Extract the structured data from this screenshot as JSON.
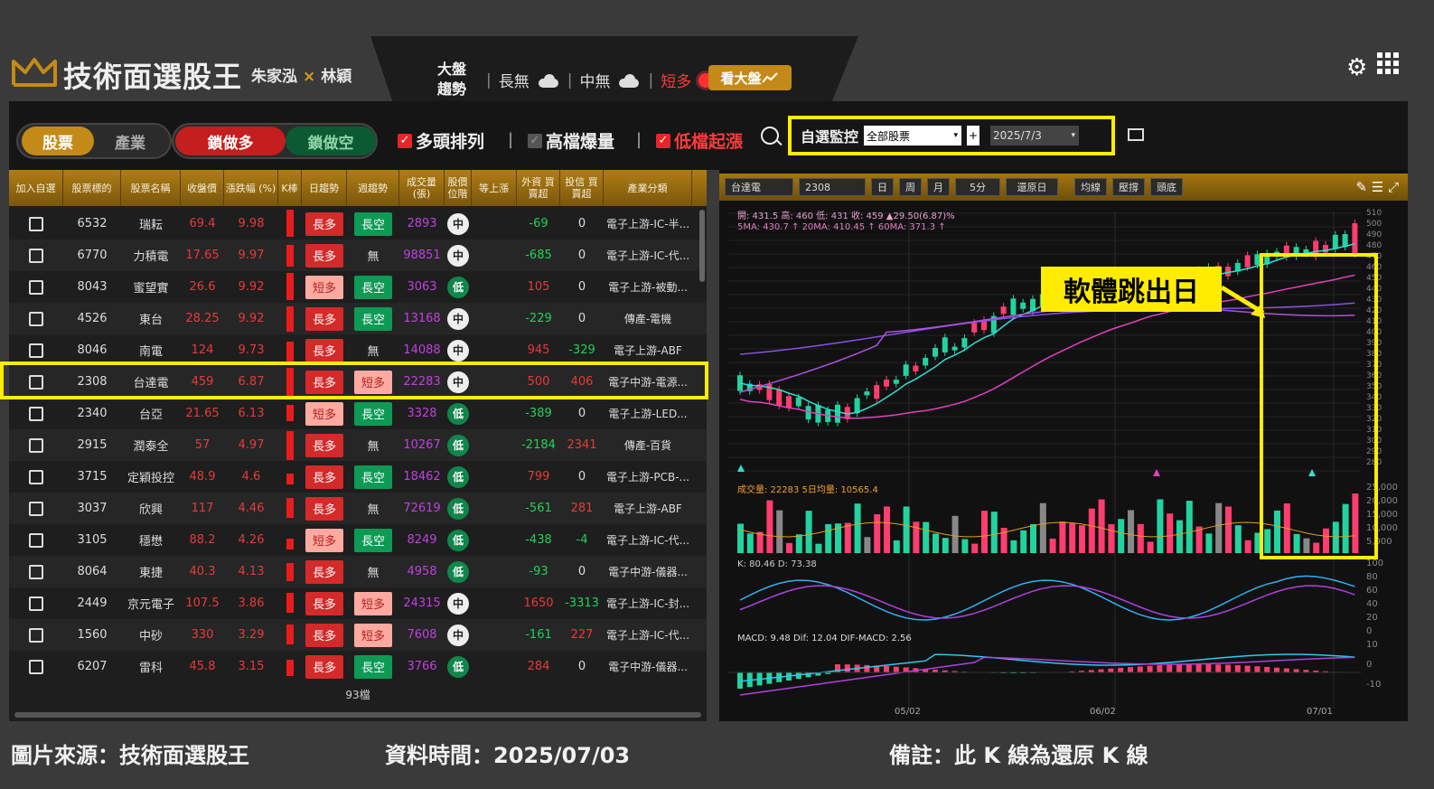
{
  "header": {
    "app_title": "技術面選股王",
    "author_1": "朱家泓",
    "author_sep": "×",
    "author_2": "林穎",
    "trend_title": "大盤趨勢",
    "trend_long": "長無",
    "trend_mid": "中無",
    "trend_short": "短多",
    "market_button": "看大盤",
    "icons": [
      "crown-logo-icon",
      "cloud-icon",
      "sun-icon",
      "chart-icon",
      "gear-icon",
      "grid-icon"
    ]
  },
  "toolbar": {
    "seg1": [
      "股票",
      "產業"
    ],
    "seg2": [
      "鎖做多",
      "鎖做空"
    ],
    "filters": [
      {
        "label": "多頭排列",
        "checked": true
      },
      {
        "label": "高檔爆量",
        "checked": false
      },
      {
        "label": "低檔起漲",
        "checked": true
      }
    ],
    "monitor_label": "自選監控",
    "monitor_select": "全部股票",
    "monitor_plus": "+",
    "date_select": "2025/7/3"
  },
  "table": {
    "headers": [
      "加入自選",
      "股票標的",
      "股票名稱",
      "收盤價",
      "漲跌幅 (%)",
      "K棒",
      "日趨勢",
      "週趨勢",
      "成交量 (張)",
      "股價位階",
      "等上漲",
      "外資 買賣超",
      "投信 買賣超",
      "產業分類"
    ],
    "rows": [
      {
        "code": "6532",
        "name": "瑞耘",
        "close": "69.4",
        "chg": "9.98",
        "day": "長多",
        "week": "長空",
        "vol": "2893",
        "pos": "中",
        "foreign": "-69",
        "trust": "0",
        "ind": "電子上游-IC-半..."
      },
      {
        "code": "6770",
        "name": "力積電",
        "close": "17.65",
        "chg": "9.97",
        "day": "長多",
        "week": "無",
        "vol": "98851",
        "pos": "中",
        "foreign": "-685",
        "trust": "0",
        "ind": "電子上游-IC-代..."
      },
      {
        "code": "8043",
        "name": "蜜望實",
        "close": "26.6",
        "chg": "9.92",
        "day": "短多",
        "week": "長空",
        "vol": "3063",
        "pos": "低",
        "foreign": "105",
        "trust": "0",
        "ind": "電子上游-被動..."
      },
      {
        "code": "4526",
        "name": "東台",
        "close": "28.25",
        "chg": "9.92",
        "day": "長多",
        "week": "長空",
        "vol": "13168",
        "pos": "中",
        "foreign": "-229",
        "trust": "0",
        "ind": "傳產-電機"
      },
      {
        "code": "8046",
        "name": "南電",
        "close": "124",
        "chg": "9.73",
        "day": "長多",
        "week": "無",
        "vol": "14088",
        "pos": "中",
        "foreign": "945",
        "trust": "-329",
        "ind": "電子上游-ABF"
      },
      {
        "code": "2308",
        "name": "台達電",
        "close": "459",
        "chg": "6.87",
        "day": "長多",
        "week": "短多",
        "vol": "22283",
        "pos": "中",
        "foreign": "500",
        "trust": "406",
        "ind": "電子中游-電源..."
      },
      {
        "code": "2340",
        "name": "台亞",
        "close": "21.65",
        "chg": "6.13",
        "day": "短多",
        "week": "長空",
        "vol": "3328",
        "pos": "低",
        "foreign": "-389",
        "trust": "0",
        "ind": "電子上游-LED..."
      },
      {
        "code": "2915",
        "name": "潤泰全",
        "close": "57",
        "chg": "4.97",
        "day": "長多",
        "week": "無",
        "vol": "10267",
        "pos": "低",
        "foreign": "-2184",
        "trust": "2341",
        "ind": "傳產-百貨"
      },
      {
        "code": "3715",
        "name": "定穎投控",
        "close": "48.9",
        "chg": "4.6",
        "day": "長多",
        "week": "長空",
        "vol": "18462",
        "pos": "低",
        "foreign": "799",
        "trust": "0",
        "ind": "電子上游-PCB-..."
      },
      {
        "code": "3037",
        "name": "欣興",
        "close": "117",
        "chg": "4.46",
        "day": "長多",
        "week": "無",
        "vol": "72619",
        "pos": "低",
        "foreign": "-561",
        "trust": "281",
        "ind": "電子上游-ABF"
      },
      {
        "code": "3105",
        "name": "穩懋",
        "close": "88.2",
        "chg": "4.26",
        "day": "短多",
        "week": "長空",
        "vol": "8249",
        "pos": "低",
        "foreign": "-438",
        "trust": "-4",
        "ind": "電子上游-IC-代..."
      },
      {
        "code": "8064",
        "name": "東捷",
        "close": "40.3",
        "chg": "4.13",
        "day": "長多",
        "week": "無",
        "vol": "4958",
        "pos": "低",
        "foreign": "-93",
        "trust": "0",
        "ind": "電子中游-儀器..."
      },
      {
        "code": "2449",
        "name": "京元電子",
        "close": "107.5",
        "chg": "3.86",
        "day": "長多",
        "week": "短多",
        "vol": "24315",
        "pos": "中",
        "foreign": "1650",
        "trust": "-3313",
        "ind": "電子上游-IC-封..."
      },
      {
        "code": "1560",
        "name": "中砂",
        "close": "330",
        "chg": "3.29",
        "day": "長多",
        "week": "短多",
        "vol": "7608",
        "pos": "中",
        "foreign": "-161",
        "trust": "227",
        "ind": "電子上游-IC-代..."
      },
      {
        "code": "6207",
        "name": "雷科",
        "close": "45.8",
        "chg": "3.15",
        "day": "長多",
        "week": "長空",
        "vol": "3766",
        "pos": "低",
        "foreign": "284",
        "trust": "0",
        "ind": "電子中游-儀器..."
      }
    ],
    "count": "93檔"
  },
  "chart": {
    "stock_name": "台達電",
    "stock_code": "2308",
    "btns": [
      "日",
      "周",
      "月",
      "5分",
      "還原日",
      "均線",
      "壓撐",
      "頭底"
    ],
    "ohlc_line": "開: 431.5  高: 460  低: 431  收: 459  ▲29.50(6.87)%",
    "ma_line": "5MA: 430.7 ↑  20MA: 410.45 ↑  60MA: 371.3 ↑",
    "vol_line": "成交量: 22283   5日均量: 10565.4",
    "kd_line": "K: 80.46   D: 73.38",
    "macd_line": "MACD: 9.48   Dif: 12.04   DIF-MACD: 2.56",
    "price_ticks": [
      "510",
      "500",
      "490",
      "480",
      "470",
      "460",
      "450",
      "440",
      "430",
      "420",
      "410",
      "400",
      "390",
      "380",
      "370",
      "360",
      "350",
      "340",
      "330",
      "320",
      "310",
      "300",
      "290",
      "280"
    ],
    "vol_ticks": [
      "25,000",
      "20,000",
      "15,000",
      "10,000",
      "5,000"
    ],
    "kd_ticks": [
      "100",
      "80",
      "60",
      "40",
      "20",
      "0"
    ],
    "macd_ticks": [
      "10",
      "0",
      "-10"
    ],
    "x_ticks": [
      "05/02",
      "06/02",
      "07/01"
    ],
    "callout": "軟體跳出日"
  },
  "notes": {
    "source": "圖片來源：技術面選股王",
    "time": "資料時間：2025/07/03",
    "remark": "備註：此 K 線為還原 K 線"
  },
  "colors": {
    "accent_gold": "#c48a17",
    "highlight_yellow": "#ffec00",
    "up_red": "#e8242a",
    "down_green": "#0e9a55"
  }
}
